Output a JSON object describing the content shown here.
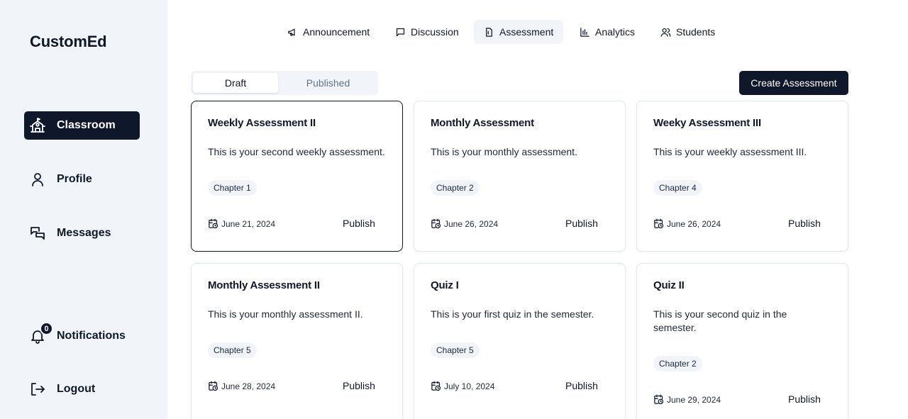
{
  "app": {
    "brand": "CustomEd"
  },
  "sidebar": {
    "items": [
      {
        "label": "Classroom",
        "icon": "school-icon"
      },
      {
        "label": "Profile",
        "icon": "user-icon"
      },
      {
        "label": "Messages",
        "icon": "messages-icon"
      },
      {
        "label": "Notifications",
        "icon": "bell-icon",
        "badge": "0"
      },
      {
        "label": "Logout",
        "icon": "logout-icon"
      }
    ]
  },
  "tabs": [
    {
      "label": "Announcement",
      "icon": "megaphone-icon"
    },
    {
      "label": "Discussion",
      "icon": "message-square-icon"
    },
    {
      "label": "Assessment",
      "icon": "file-icon",
      "active": true
    },
    {
      "label": "Analytics",
      "icon": "bar-chart-icon"
    },
    {
      "label": "Students",
      "icon": "users-icon"
    }
  ],
  "toggle": {
    "draft": "Draft",
    "published": "Published",
    "active": "draft"
  },
  "actions": {
    "create": "Create Assessment"
  },
  "cards": [
    {
      "title": "Weekly Assessment II",
      "description": "This is your second weekly assessment.",
      "chapter": "Chapter 1",
      "date": "June 21, 2024",
      "action": "Publish",
      "selected": true
    },
    {
      "title": "Monthly Assessment",
      "description": "This is your monthly assessment.",
      "chapter": "Chapter 2",
      "date": "June 26, 2024",
      "action": "Publish"
    },
    {
      "title": "Weeky Assessment III",
      "description": "This is your weekly assessment III.",
      "chapter": "Chapter 4",
      "date": "June 26, 2024",
      "action": "Publish"
    },
    {
      "title": "Monthly Assessment II",
      "description": "This is your monthly assessment II.",
      "chapter": "Chapter 5",
      "date": "June 28, 2024",
      "action": "Publish"
    },
    {
      "title": "Quiz I",
      "description": "This is your first quiz in the semester.",
      "chapter": "Chapter 5",
      "date": "July 10, 2024",
      "action": "Publish"
    },
    {
      "title": "Quiz II",
      "description": "This is your second quiz in the semester.",
      "chapter": "Chapter 2",
      "date": "June 29, 2024",
      "action": "Publish"
    }
  ],
  "colors": {
    "primary": "#0f172a",
    "sidebar_bg": "#f1f5f9",
    "muted_text": "#64748b",
    "border": "#e2e8f0"
  }
}
